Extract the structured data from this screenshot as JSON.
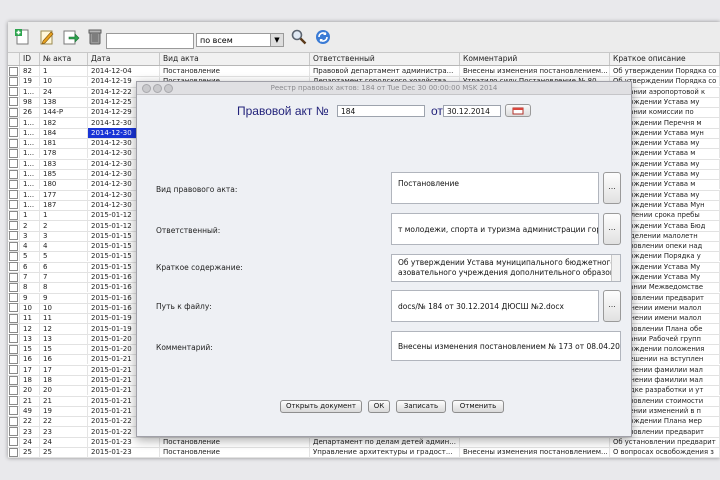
{
  "toolbar": {
    "search_value": "",
    "scope_value": "по всем",
    "icons": [
      "add-document-icon",
      "edit-icon",
      "export-icon",
      "trash-icon",
      "search-icon",
      "refresh-icon"
    ]
  },
  "grid": {
    "columns": [
      "ID",
      "№ акта",
      "Дата",
      "Вид акта",
      "Ответственный",
      "Комментарий",
      "Краткое описание"
    ],
    "rows": [
      {
        "id": "82",
        "num": "1",
        "date": "2014-12-04",
        "kind": "Постановление",
        "resp": "Правовой департамент администра...",
        "comment": "Внесены изменения постановлением...",
        "desc": "Об утверждении Порядка со"
      },
      {
        "id": "19",
        "num": "10",
        "date": "2014-12-19",
        "kind": "Постановление",
        "resp": "Департамент городского хозяйства...",
        "comment": "Утратило силу Постановление № 80...",
        "desc": "Об утверждении Порядка со"
      },
      {
        "id": "1...",
        "num": "24",
        "date": "2014-12-22",
        "kind": "",
        "resp": "",
        "comment": "",
        "desc": "создании аэропортовой к"
      },
      {
        "id": "98",
        "num": "138",
        "date": "2014-12-25",
        "kind": "",
        "resp": "",
        "comment": "",
        "desc": "утверждении Устава му"
      },
      {
        "id": "26",
        "num": "144-P",
        "date": "2014-12-29",
        "kind": "",
        "resp": "",
        "comment": "",
        "desc": "создании комиссии по"
      },
      {
        "id": "1...",
        "num": "182",
        "date": "2014-12-30",
        "kind": "",
        "resp": "",
        "comment": "",
        "desc": "утверждении Перечня м"
      },
      {
        "id": "1...",
        "num": "184",
        "date": "2014-12-30",
        "kind": "",
        "resp": "",
        "comment": "",
        "desc": "утверждении Устава мун",
        "selected": true
      },
      {
        "id": "1...",
        "num": "181",
        "date": "2014-12-30",
        "kind": "",
        "resp": "",
        "comment": "",
        "desc": "утверждении Устава му"
      },
      {
        "id": "1...",
        "num": "178",
        "date": "2014-12-30",
        "kind": "",
        "resp": "",
        "comment": "",
        "desc": "утверждении Устава м"
      },
      {
        "id": "1...",
        "num": "183",
        "date": "2014-12-30",
        "kind": "",
        "resp": "",
        "comment": "",
        "desc": "утверждении Устава му"
      },
      {
        "id": "1...",
        "num": "185",
        "date": "2014-12-30",
        "kind": "",
        "resp": "",
        "comment": "",
        "desc": "утверждении Устава му"
      },
      {
        "id": "1...",
        "num": "180",
        "date": "2014-12-30",
        "kind": "",
        "resp": "",
        "comment": "",
        "desc": "утверждении Устава м"
      },
      {
        "id": "1...",
        "num": "177",
        "date": "2014-12-30",
        "kind": "",
        "resp": "",
        "comment": "",
        "desc": "утверждении Устава му"
      },
      {
        "id": "1...",
        "num": "187",
        "date": "2014-12-30",
        "kind": "",
        "resp": "",
        "comment": "",
        "desc": "утверждении Устава Мун"
      },
      {
        "id": "1",
        "num": "1",
        "date": "2015-01-12",
        "kind": "",
        "resp": "",
        "comment": "",
        "desc": "продлении срока пребы"
      },
      {
        "id": "2",
        "num": "2",
        "date": "2015-01-12",
        "kind": "",
        "resp": "",
        "comment": "",
        "desc": "утверждении Устава Бюд"
      },
      {
        "id": "3",
        "num": "3",
        "date": "2015-01-15",
        "kind": "",
        "resp": "",
        "comment": "",
        "desc": "определении малолетн"
      },
      {
        "id": "4",
        "num": "4",
        "date": "2015-01-15",
        "kind": "",
        "resp": "",
        "comment": "",
        "desc": "установлении опеки над"
      },
      {
        "id": "5",
        "num": "5",
        "date": "2015-01-15",
        "kind": "",
        "resp": "",
        "comment": "",
        "desc": "утверждении Порядка у"
      },
      {
        "id": "6",
        "num": "6",
        "date": "2015-01-15",
        "kind": "",
        "resp": "",
        "comment": "",
        "desc": "утверждении Устава Му"
      },
      {
        "id": "7",
        "num": "7",
        "date": "2015-01-16",
        "kind": "",
        "resp": "",
        "comment": "",
        "desc": "утверждении Устава Му"
      },
      {
        "id": "8",
        "num": "8",
        "date": "2015-01-16",
        "kind": "",
        "resp": "",
        "comment": "",
        "desc": "создании Межведомстве"
      },
      {
        "id": "9",
        "num": "9",
        "date": "2015-01-16",
        "kind": "",
        "resp": "",
        "comment": "",
        "desc": "установлении предварит"
      },
      {
        "id": "10",
        "num": "10",
        "date": "2015-01-16",
        "kind": "",
        "resp": "",
        "comment": "",
        "desc": "изменении имени малол"
      },
      {
        "id": "11",
        "num": "11",
        "date": "2015-01-19",
        "kind": "",
        "resp": "",
        "comment": "",
        "desc": "изменении имени малол"
      },
      {
        "id": "12",
        "num": "12",
        "date": "2015-01-19",
        "kind": "",
        "resp": "",
        "comment": "",
        "desc": "установлении Плана обе"
      },
      {
        "id": "13",
        "num": "13",
        "date": "2015-01-20",
        "kind": "",
        "resp": "",
        "comment": "",
        "desc": "создании Рабочей групп"
      },
      {
        "id": "15",
        "num": "15",
        "date": "2015-01-20",
        "kind": "",
        "resp": "",
        "comment": "",
        "desc": "утверждении положения"
      },
      {
        "id": "16",
        "num": "16",
        "date": "2015-01-21",
        "kind": "",
        "resp": "",
        "comment": "",
        "desc": "разрешении на вступлен"
      },
      {
        "id": "17",
        "num": "17",
        "date": "2015-01-21",
        "kind": "",
        "resp": "",
        "comment": "",
        "desc": "изменении фамилии мал"
      },
      {
        "id": "18",
        "num": "18",
        "date": "2015-01-21",
        "kind": "",
        "resp": "",
        "comment": "",
        "desc": "изменении фамилии мал"
      },
      {
        "id": "20",
        "num": "20",
        "date": "2015-01-21",
        "kind": "",
        "resp": "",
        "comment": "",
        "desc": "порядке разработки и ут"
      },
      {
        "id": "21",
        "num": "21",
        "date": "2015-01-21",
        "kind": "",
        "resp": "",
        "comment": "",
        "desc": "установлении стоимости"
      },
      {
        "id": "49",
        "num": "19",
        "date": "2015-01-21",
        "kind": "",
        "resp": "",
        "comment": "",
        "desc": "внесении изменений в п"
      },
      {
        "id": "22",
        "num": "22",
        "date": "2015-01-22",
        "kind": "",
        "resp": "",
        "comment": "",
        "desc": "утверждении Плана мер"
      },
      {
        "id": "23",
        "num": "23",
        "date": "2015-01-22",
        "kind": "",
        "resp": "",
        "comment": "",
        "desc": "установлении предварит"
      },
      {
        "id": "24",
        "num": "24",
        "date": "2015-01-23",
        "kind": "Постановление",
        "resp": "Департамент по делам детей админ...",
        "comment": "",
        "desc": "Об установлении предварит"
      },
      {
        "id": "25",
        "num": "25",
        "date": "2015-01-23",
        "kind": "Постановление",
        "resp": "Управление архитектуры и градост...",
        "comment": "Внесены изменения постановлением...",
        "desc": "О вопросах освобождения з"
      },
      {
        "id": "26",
        "num": "26",
        "date": "2015-01-23",
        "kind": "Постановление",
        "resp": "Управление муниципальных закупо...",
        "comment": "Отменено (№ 2 от 30.08 2015 ...",
        "desc": "Об утверждении Положени"
      },
      {
        "id": "27",
        "num": "27",
        "date": "2015-01-23",
        "kind": "Постановление",
        "resp": "Управление муниципальных закупо...",
        "comment": "",
        "desc": "Об утверждении Положени"
      }
    ]
  },
  "dialog": {
    "window_title": "Реестр правовых актов: 184 от Tue Dec 30 00:00:00 MSK 2014",
    "heading_prefix": "Правовой акт №",
    "number": "184",
    "from_label": "от",
    "date": "30.12.2014",
    "fields": [
      {
        "label": "Вид правового акта:",
        "value": "Постановление"
      },
      {
        "label": "Ответственный:",
        "value": "т молодежи, спорта и туризма администрации города"
      },
      {
        "label": "Краткое содержание:",
        "value_line1": "Об утверждении Устава муниципального бюджетного обр",
        "value_line2": "азовательного учреждения дополнительного образования"
      },
      {
        "label": "Путь к файлу:",
        "value": "docs/№ 184 от 30.12.2014 ДЮСШ  №2.docx"
      },
      {
        "label": "Комментарий:",
        "value": "Внесены изменения постановлением № 173 от 08.04.2015"
      }
    ],
    "ellipsis": "...",
    "buttons": {
      "open": "Открыть документ",
      "ok": "ОК",
      "save": "Записать",
      "cancel": "Отменить"
    }
  }
}
